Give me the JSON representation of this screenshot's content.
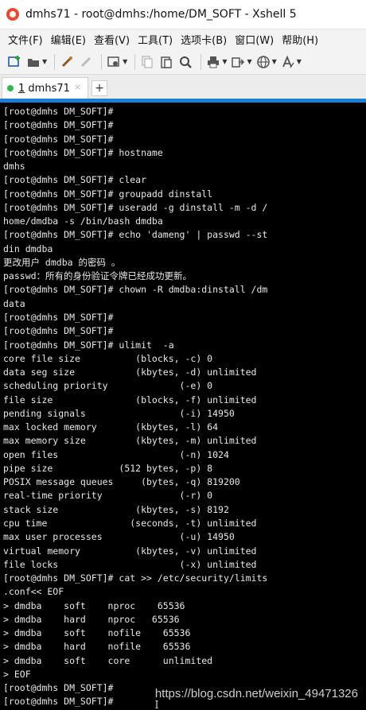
{
  "window": {
    "title": "dmhs71 - root@dmhs:/home/DM_SOFT - Xshell 5"
  },
  "menu": {
    "items": [
      "文件(F)",
      "编辑(E)",
      "查看(V)",
      "工具(T)",
      "选项卡(B)",
      "窗口(W)",
      "帮助(H)"
    ]
  },
  "toolbar": {
    "icons": [
      "new-session-icon",
      "open-folder-icon",
      "connect-icon",
      "disconnect-icon",
      "session-settings-icon",
      "copy-icon",
      "paste-icon",
      "find-icon",
      "print-icon",
      "transfer-icon",
      "globe-icon",
      "font-icon"
    ]
  },
  "tabs": {
    "items": [
      {
        "num": "1",
        "label": "dmhs71"
      }
    ],
    "close_glyph": "×",
    "new_tab_glyph": "+"
  },
  "colors": {
    "terminal_bg": "#000000",
    "terminal_fg": "#e8e8e8",
    "tab_accent": "#1c7ed6",
    "tab_status": "#2fb84a"
  },
  "terminal": {
    "lines": [
      "[root@dmhs DM_SOFT]#",
      "[root@dmhs DM_SOFT]#",
      "[root@dmhs DM_SOFT]#",
      "[root@dmhs DM_SOFT]# hostname",
      "dmhs",
      "[root@dmhs DM_SOFT]# clear",
      "[root@dmhs DM_SOFT]# groupadd dinstall",
      "[root@dmhs DM_SOFT]# useradd -g dinstall -m -d /",
      "home/dmdba -s /bin/bash dmdba",
      "[root@dmhs DM_SOFT]# echo 'dameng' | passwd --st",
      "din dmdba",
      "更改用户 dmdba 的密码 。",
      "passwd：所有的身份验证令牌已经成功更新。",
      "[root@dmhs DM_SOFT]# chown -R dmdba:dinstall /dm",
      "data",
      "[root@dmhs DM_SOFT]#",
      "[root@dmhs DM_SOFT]#",
      "[root@dmhs DM_SOFT]# ulimit  -a",
      "core file size          (blocks, -c) 0",
      "data seg size           (kbytes, -d) unlimited",
      "scheduling priority             (-e) 0",
      "file size               (blocks, -f) unlimited",
      "pending signals                 (-i) 14950",
      "max locked memory       (kbytes, -l) 64",
      "max memory size         (kbytes, -m) unlimited",
      "open files                      (-n) 1024",
      "pipe size            (512 bytes, -p) 8",
      "POSIX message queues     (bytes, -q) 819200",
      "real-time priority              (-r) 0",
      "stack size              (kbytes, -s) 8192",
      "cpu time               (seconds, -t) unlimited",
      "max user processes              (-u) 14950",
      "virtual memory          (kbytes, -v) unlimited",
      "file locks                      (-x) unlimited",
      "[root@dmhs DM_SOFT]# cat >> /etc/security/limits",
      ".conf<< EOF",
      "> dmdba    soft    nproc    65536",
      "> dmdba    hard    nproc   65536",
      "> dmdba    soft    nofile    65536",
      "> dmdba    hard    nofile    65536",
      "> dmdba    soft    core      unlimited",
      "> EOF",
      "[root@dmhs DM_SOFT]#",
      "[root@dmhs DM_SOFT]#"
    ],
    "watermark": "https://blog.csdn.net/weixin_49471326"
  }
}
